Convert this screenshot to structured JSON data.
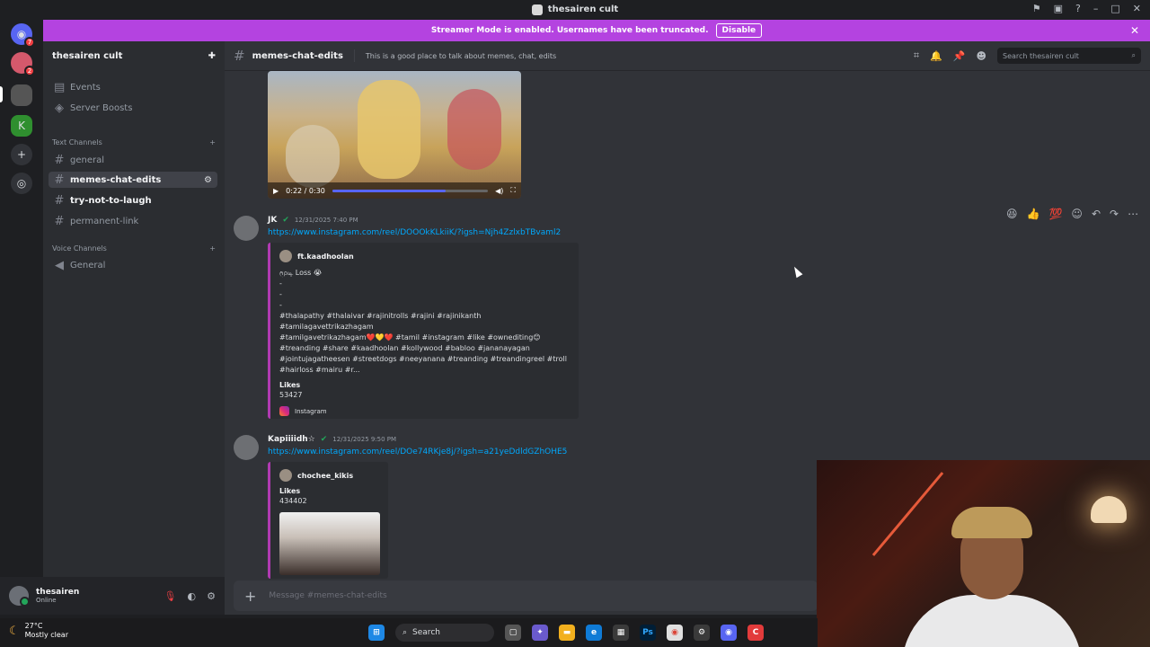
{
  "window": {
    "title": "thesairen cult"
  },
  "banner": {
    "text": "Streamer Mode is enabled. Usernames have been truncated.",
    "disable_label": "Disable"
  },
  "guilds": {
    "badges": [
      "7",
      "2"
    ]
  },
  "server": {
    "name": "thesairen cult",
    "top_items": [
      {
        "label": "Events"
      },
      {
        "label": "Server Boosts"
      }
    ],
    "text_category": "Text Channels",
    "text_channels": [
      {
        "name": "general"
      },
      {
        "name": "memes-chat-edits"
      },
      {
        "name": "try-not-to-laugh"
      },
      {
        "name": "permanent-link"
      }
    ],
    "voice_category": "Voice Channels",
    "voice_channels": [
      {
        "name": "General"
      }
    ]
  },
  "user": {
    "name": "thesairen",
    "status": "Online"
  },
  "channel": {
    "name": "memes-chat-edits",
    "topic": "This is a good place to talk about memes, chat, edits",
    "search_placeholder": "Search thesairen cult"
  },
  "video": {
    "time": "0:22 / 0:30",
    "progress": 0.73
  },
  "messages": [
    {
      "author": "JK",
      "timestamp": "12/31/2025 7:40 PM",
      "link": "https://www.instagram.com/reel/DOOOkKLkiiK/?igsh=Njh4ZzlxbTBvaml2",
      "embed": {
        "author": "ft.kaadhoolan",
        "text": "மூடி Loss 😭\n-\n-\n-\n#thalapathy #thalaivar #rajinitrolls #rajini #rajinikanth #tamilagavettrikazhagam\n#tamilgavetrikazhagam❤️💛❤️ #tamil #instagram #like #ownediting😊\n#treanding #share #kaadhoolan #kollywood #babloo #jananayagan\n#jointujagatheesen #streetdogs #neeyanana #treanding #treandingreel #troll\n#hairloss #mairu #r...",
        "field_label": "Likes",
        "field_value": "53427",
        "footer": "Instagram"
      }
    },
    {
      "author": "Kapiiiidh☆",
      "timestamp": "12/31/2025 9:50 PM",
      "link": "https://www.instagram.com/reel/DOe74RKje8j/?igsh=a21yeDdldGZhOHE5",
      "embed": {
        "author": "chochee_kikis",
        "field_label": "Likes",
        "field_value": "434402"
      }
    }
  ],
  "composer": {
    "placeholder": "Message #memes-chat-edits"
  },
  "taskbar": {
    "temp": "27°C",
    "condition": "Mostly clear",
    "search_label": "Search"
  }
}
